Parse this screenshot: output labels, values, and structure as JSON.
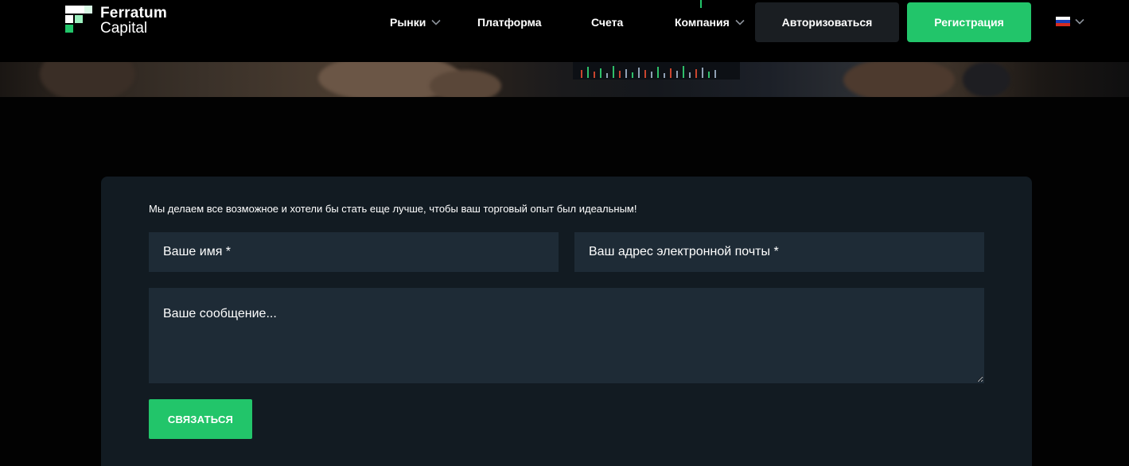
{
  "brand": {
    "name_line1": "Ferratum",
    "name_line2": "Capital",
    "accent_color": "#22c56a"
  },
  "nav": {
    "items": [
      {
        "label": "Рынки",
        "has_dropdown": true
      },
      {
        "label": "Платформа",
        "has_dropdown": false
      },
      {
        "label": "Счета",
        "has_dropdown": false
      },
      {
        "label": "Компания",
        "has_dropdown": true
      }
    ],
    "login_label": "Авторизоваться",
    "register_label": "Регистрация",
    "language_icon": "russia-flag-icon"
  },
  "contact_form": {
    "intro": "Мы делаем все возможное и хотели бы стать еще лучше, чтобы ваш торговый опыт был идеальным!",
    "name_placeholder": "Ваше имя *",
    "email_placeholder": "Ваш адрес электронной почты *",
    "message_placeholder": "Ваше сообщение...",
    "submit_label": "СВЯЗАТЬСЯ"
  }
}
